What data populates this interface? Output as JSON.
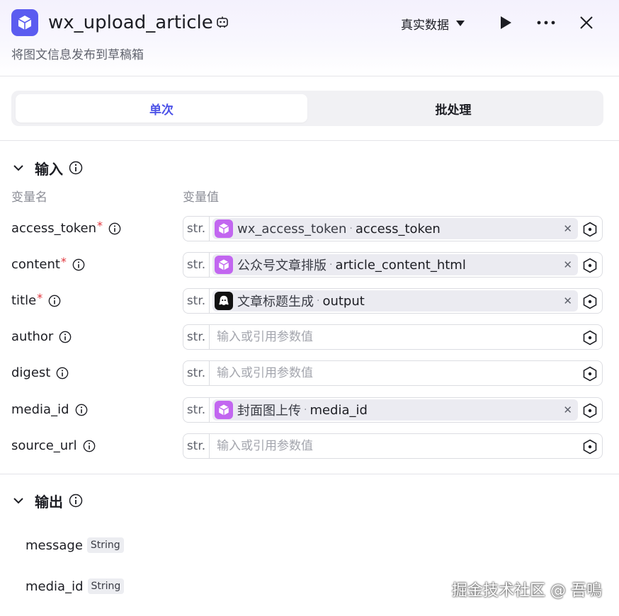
{
  "header": {
    "title": "wx_upload_article",
    "subtitle": "将图文信息发布到草稿箱",
    "data_mode_label": "真实数据",
    "accent_color": "#5b5cf0"
  },
  "tabs": [
    {
      "label": "单次",
      "active": true
    },
    {
      "label": "批处理",
      "active": false
    }
  ],
  "input_section": {
    "title": "输入",
    "col_name_label": "变量名",
    "col_value_label": "变量值",
    "type_tag": "str.",
    "placeholder": "输入或引用参数值",
    "params": [
      {
        "name": "access_token",
        "required": true,
        "ref_node": "wx_access_token",
        "ref_sep": "·",
        "ref_var": "access_token",
        "node_icon": "plugin-cube-icon"
      },
      {
        "name": "content",
        "required": true,
        "ref_node": "公众号文章排版",
        "ref_sep": "·",
        "ref_var": "article_content_html",
        "node_icon": "plugin-cube-icon"
      },
      {
        "name": "title",
        "required": true,
        "ref_node": "文章标题生成",
        "ref_sep": "·",
        "ref_var": "output",
        "node_icon": "llm-bot-icon"
      },
      {
        "name": "author",
        "required": false
      },
      {
        "name": "digest",
        "required": false
      },
      {
        "name": "media_id",
        "required": false,
        "ref_node": "封面图上传",
        "ref_sep": "·",
        "ref_var": "media_id",
        "node_icon": "plugin-cube-icon"
      },
      {
        "name": "source_url",
        "required": false
      }
    ]
  },
  "output_section": {
    "title": "输出",
    "outputs": [
      {
        "name": "message",
        "type": "String"
      },
      {
        "name": "media_id",
        "type": "String"
      }
    ]
  },
  "watermark": "掘金技术社区 @ 吾鳴"
}
